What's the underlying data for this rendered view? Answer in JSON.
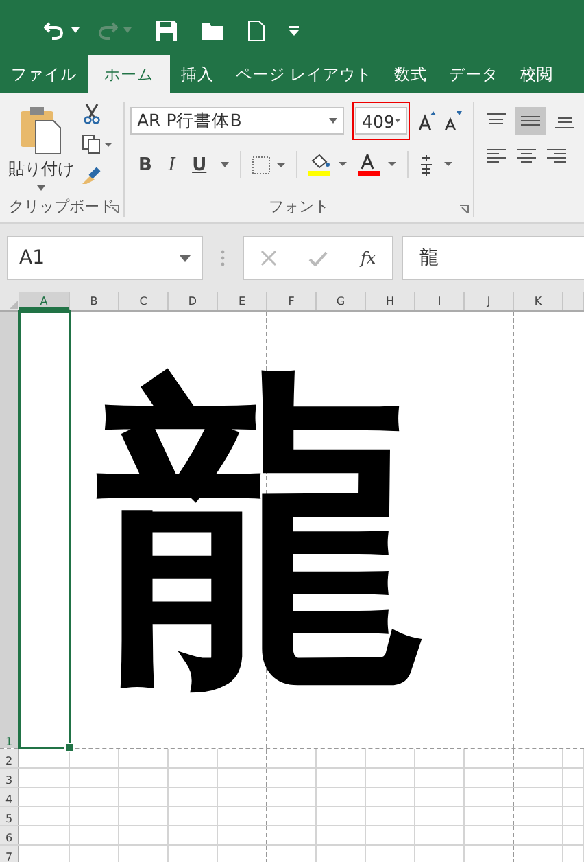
{
  "tabs": [
    {
      "label": "ファイル",
      "selected": false
    },
    {
      "label": "ホーム",
      "selected": true
    },
    {
      "label": "挿入",
      "selected": false
    },
    {
      "label": "ページ レイアウト",
      "selected": false
    },
    {
      "label": "数式",
      "selected": false
    },
    {
      "label": "データ",
      "selected": false
    },
    {
      "label": "校閲",
      "selected": false
    }
  ],
  "clipboard": {
    "paste_label": "貼り付け",
    "group_label": "クリップボード"
  },
  "font": {
    "name": "AR P行書体B",
    "size": "409",
    "size_highlighted": true,
    "group_label": "フォント",
    "bold": "B",
    "italic": "I",
    "underline": "U"
  },
  "formula_bar": {
    "name_box": "A1",
    "fx": "fx",
    "formula": "龍"
  },
  "columns": [
    "A",
    "B",
    "C",
    "D",
    "E",
    "F",
    "G",
    "H",
    "I",
    "J",
    "K"
  ],
  "rows": [
    "1",
    "2",
    "3",
    "4",
    "5",
    "6",
    "7"
  ],
  "active_cell": {
    "value": "龍",
    "selected": true
  }
}
